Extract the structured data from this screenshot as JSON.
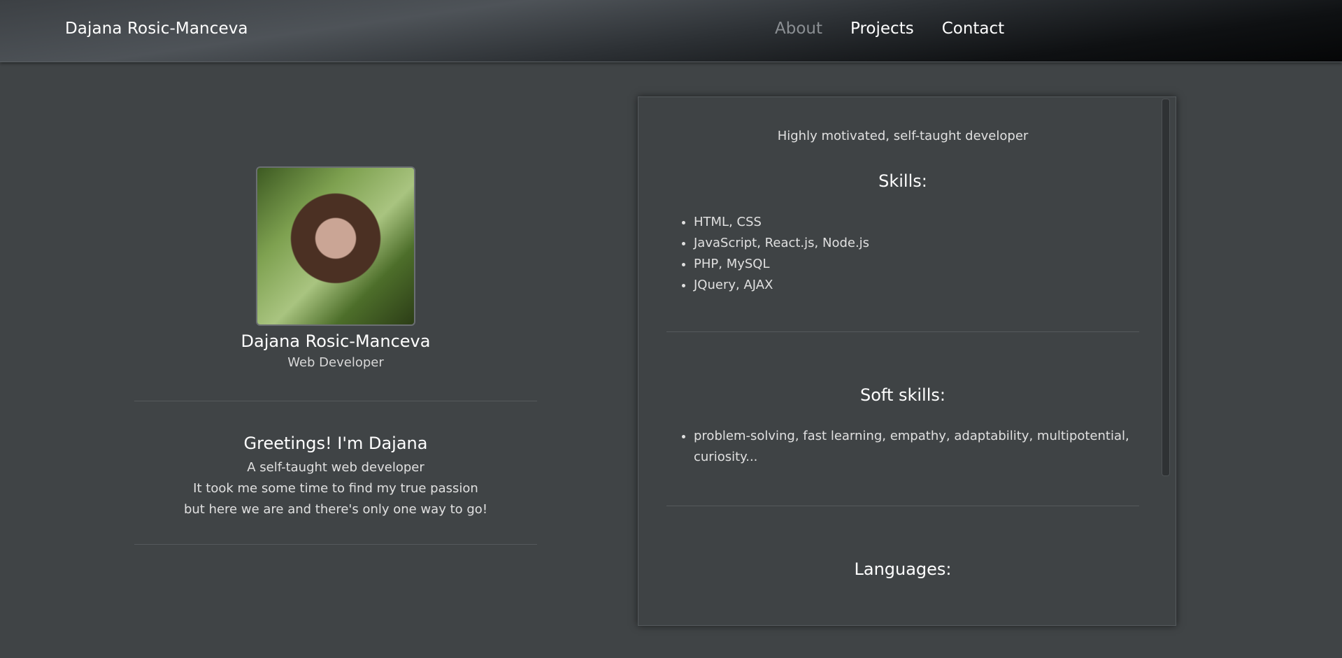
{
  "header": {
    "brand": "Dajana Rosic-Manceva",
    "nav": [
      "About",
      "Projects",
      "Contact"
    ]
  },
  "profile": {
    "avatar_alt": "profile-photo",
    "name": "Dajana Rosic-Manceva",
    "role": "Web Developer",
    "greeting": "Greetings! I'm Dajana",
    "lines": [
      "A self-taught web developer",
      "It took me some time to find my true passion",
      "but here we are and there's only one way to go!"
    ]
  },
  "panel": {
    "tagline": "Highly motivated, self-taught developer",
    "skills_title": "Skills:",
    "skills": [
      "HTML, CSS",
      "JavaScript, React.js, Node.js",
      "PHP, MySQL",
      "JQuery, AJAX"
    ],
    "soft_title": "Soft skills:",
    "soft_skills": [
      "problem-solving, fast learning, empathy, adaptability, multipotential, curiosity..."
    ],
    "languages_title": "Languages:"
  },
  "colors": {
    "background": "#404446",
    "nav_active": "#8b8f93",
    "text": "#e6e6e6"
  }
}
